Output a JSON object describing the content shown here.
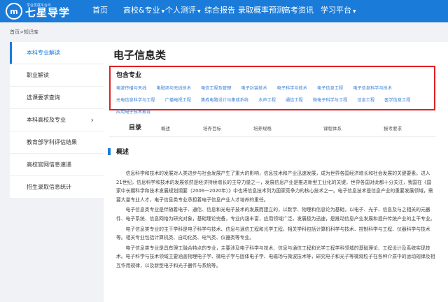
{
  "header": {
    "logo_mark": "m",
    "logo_text": "七星导学",
    "logo_tagline": "学业发展平台®",
    "nav": [
      {
        "label": "首页"
      },
      {
        "label": "高校&专业",
        "has_caret": true
      },
      {
        "label": "个人测评",
        "has_caret": true
      },
      {
        "label": "综合报告"
      },
      {
        "label": "录取概率预测"
      },
      {
        "label": "高考资讯"
      },
      {
        "label": "学习平台",
        "has_caret": true
      }
    ]
  },
  "breadcrumb": "首页>知识库",
  "sidebar": {
    "items": [
      {
        "label": "本科专业解读",
        "active": true
      },
      {
        "label": "职业解读"
      },
      {
        "label": "选课要求查询"
      },
      {
        "label": "本科高校及专业",
        "has_chevron": true
      },
      {
        "label": "教育部学科评估结果"
      },
      {
        "label": "高校官网信息速递"
      },
      {
        "label": "招生录取信息统计"
      }
    ]
  },
  "main": {
    "title": "电子信息类",
    "majors_title": "包含专业",
    "majors": [
      "电波传播与天线",
      "电磁场与无线技术",
      "电信工程及管理",
      "电子封装技术",
      "电子科学与技术",
      "电子信息工程",
      "电子信息科学与技术",
      "光电信息科学与工程",
      "广播电视工程",
      "集成电路设计与集成系统",
      "水声工程",
      "通信工程",
      "微电子科学与工程",
      "信息工程",
      "医学信息工程",
      "应用电子技术教育"
    ],
    "toc_title": "目录",
    "toc": [
      "概述",
      "培养目标",
      "培养规格",
      "课程体系",
      "报考要求"
    ],
    "section_title": "概述",
    "paragraphs": [
      "信息科学和技术的发展对人类进步与社会发展产生了重大的影响，信息技术和产业迅速发展，成为世界各国经济增长和社会发展的关键要素。进入21世纪，信息科学和技术的发展依然是经济持续增长的主导力量之一，发展信息产业是推进新型工业化的关键，世界各国对此都十分关注，我国在《国家中长期科学和技术发展规划纲要（2006—2020年）》中也将信息技术列为国家竞争力的核心技术之一。电子信息技术是信息产业的重要发展领域，需要大量专业人才，电子信息类专业承担着电子信息产业人才培养的重任。",
      "电子信息类专业是伴随着电子、通信、信息和光电子技术的发展而建立的，以数学、物理和信息论为基础，以电子、光子、信息及与之相关的元器件、电子系统、信息网络为研究对象，基础理论完备，专业内涵丰富，应用领域广泛，发展极为迅速，是推动信息产业发展和提升传统产业的主干专业。",
      "电子信息类专业的主干学科是电子科学与技术、信息与通信工程和光学工程，相关学科包括计算机科学与技术、控制科学与工程、仪器科学与技术等。相关专业包括计算机类、自动化类、电气类、仪器类等专业。",
      "电子信息类专业是具有理工融合特点的专业，主要涉及电子科学与技术、信息与通信工程和光学工程学科领域的基础理论、工程设计及系统实现技术。电子科学与技术领域主要涵盖物理电子学、微电子学与固体电子学、电磁场与微波技术等，研究电子和光子等微观粒子在各种介质中的运动规律及相互作用规律，以及新型电子和光子器件与系统等。"
    ]
  }
}
